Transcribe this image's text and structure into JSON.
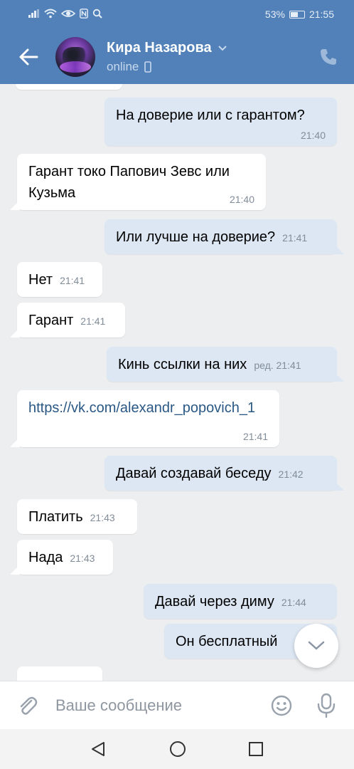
{
  "status_bar": {
    "battery": "53%",
    "time": "21:55"
  },
  "header": {
    "contact_name": "Кира Назарова",
    "presence": "online"
  },
  "messages": [
    {
      "dir": "out",
      "text": "На доверие или с гарантом?",
      "time": "21:40"
    },
    {
      "dir": "in",
      "text": "Гарант токо Папович Зевс или Кузьма",
      "time": "21:40"
    },
    {
      "dir": "out",
      "text": "Или лучше на доверие?",
      "time": "21:41"
    },
    {
      "dir": "in",
      "text": "Нет",
      "time": "21:41"
    },
    {
      "dir": "in",
      "text": "Гарант",
      "time": "21:41"
    },
    {
      "dir": "out",
      "text": "Кинь ссылки на них",
      "time": "ред. 21:41"
    },
    {
      "dir": "in",
      "text": "https://vk.com/alexandr_popovich_1",
      "time": "21:41"
    },
    {
      "dir": "out",
      "text": "Давай создавай беседу",
      "time": "21:42"
    },
    {
      "dir": "in",
      "text": "Платить",
      "time": "21:43"
    },
    {
      "dir": "in",
      "text": "Нада",
      "time": "21:43"
    },
    {
      "dir": "out",
      "text": "Давай через диму",
      "time": "21:44"
    },
    {
      "dir": "out",
      "text": "Он бесплатный",
      "time": ""
    }
  ],
  "composer": {
    "placeholder": "Ваше сообщение"
  },
  "icons": {
    "back": "arrow-left-icon",
    "phone": "phone-icon",
    "attach": "paperclip-icon",
    "emoji": "smile-icon",
    "mic": "microphone-icon",
    "scroll_down": "chevron-down-icon"
  },
  "colors": {
    "header": "#5181b8",
    "outgoing_bubble": "#dce7f3",
    "incoming_bubble": "#ffffff",
    "background": "#edeef0",
    "link": "#2a5885"
  }
}
